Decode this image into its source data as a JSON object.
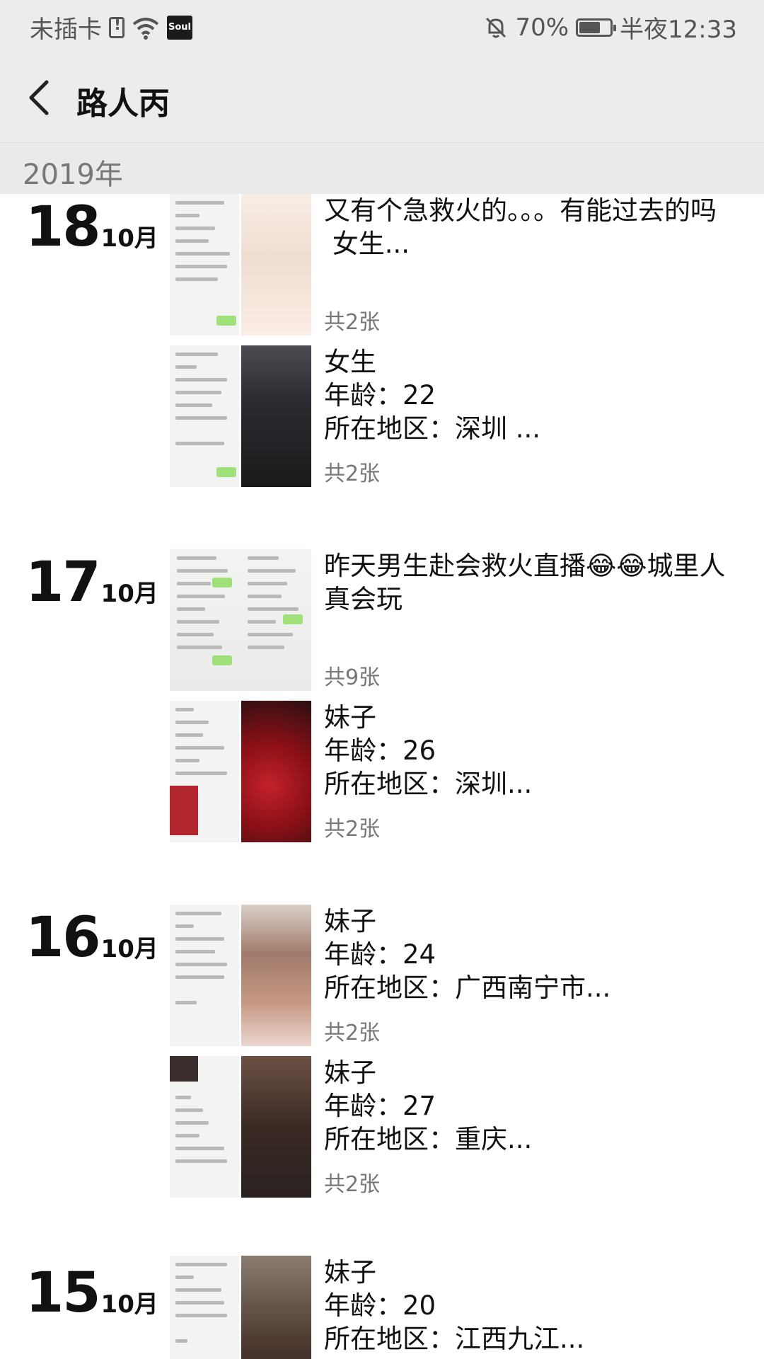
{
  "status_bar": {
    "carrier": "未插卡",
    "soul_badge": "Soul",
    "battery_percent": "70%",
    "battery_level": 0.7,
    "time": "半夜12:33"
  },
  "header": {
    "title": "路人丙"
  },
  "year_label": "2019年",
  "days": [
    {
      "day": "18",
      "month": "10月"
    },
    {
      "day": "17",
      "month": "10月"
    },
    {
      "day": "16",
      "month": "10月"
    },
    {
      "day": "15",
      "month": "10月"
    }
  ],
  "posts": [
    {
      "text": "又有个急救火的。。。有能过去的吗\n 女生...",
      "count": "共2张"
    },
    {
      "text": "女生\n年龄：22\n所在地区：深圳 ...",
      "count": "共2张"
    },
    {
      "text": "昨天男生赴会救火直播😂😂城里人真会玩",
      "count": "共9张"
    },
    {
      "text": "妹子\n年龄：26\n所在地区：深圳...",
      "count": "共2张"
    },
    {
      "text": "妹子\n年龄：24\n所在地区：广西南宁市...",
      "count": "共2张"
    },
    {
      "text": "妹子\n年龄：27\n所在地区：重庆...",
      "count": "共2张"
    },
    {
      "text": "妹子\n年龄：20\n所在地区：江西九江...",
      "count": ""
    }
  ],
  "colors": {
    "status_bg": "#ececec",
    "year_band_bg": "#eaeaea",
    "count_text": "#777777"
  }
}
